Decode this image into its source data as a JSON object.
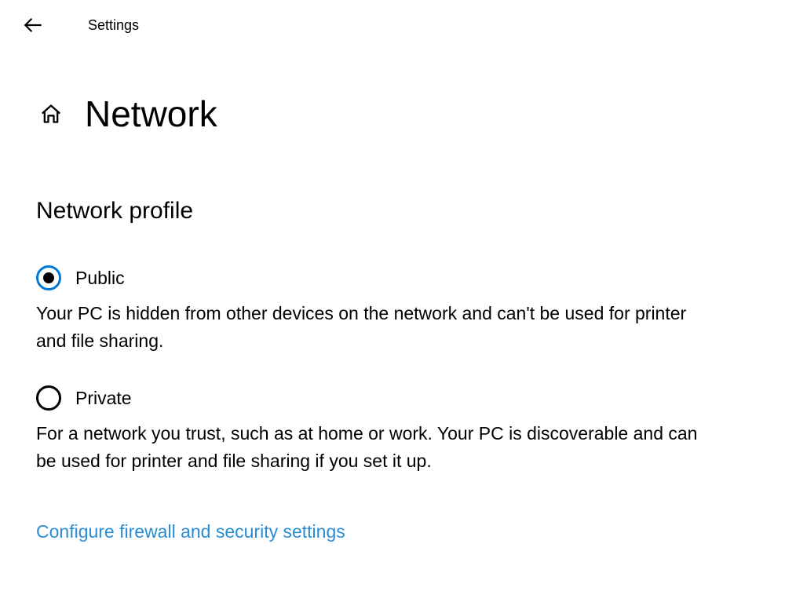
{
  "header": {
    "app_title": "Settings",
    "page_title": "Network"
  },
  "section": {
    "title": "Network profile"
  },
  "options": {
    "public": {
      "label": "Public",
      "description": "Your PC is hidden from other devices on the network and can't be used for printer and file sharing.",
      "selected": true
    },
    "private": {
      "label": "Private",
      "description": "For a network you trust, such as at home or work. Your PC is discoverable and can be used for printer and file sharing if you set it up.",
      "selected": false
    }
  },
  "link": {
    "firewall": "Configure firewall and security settings"
  }
}
